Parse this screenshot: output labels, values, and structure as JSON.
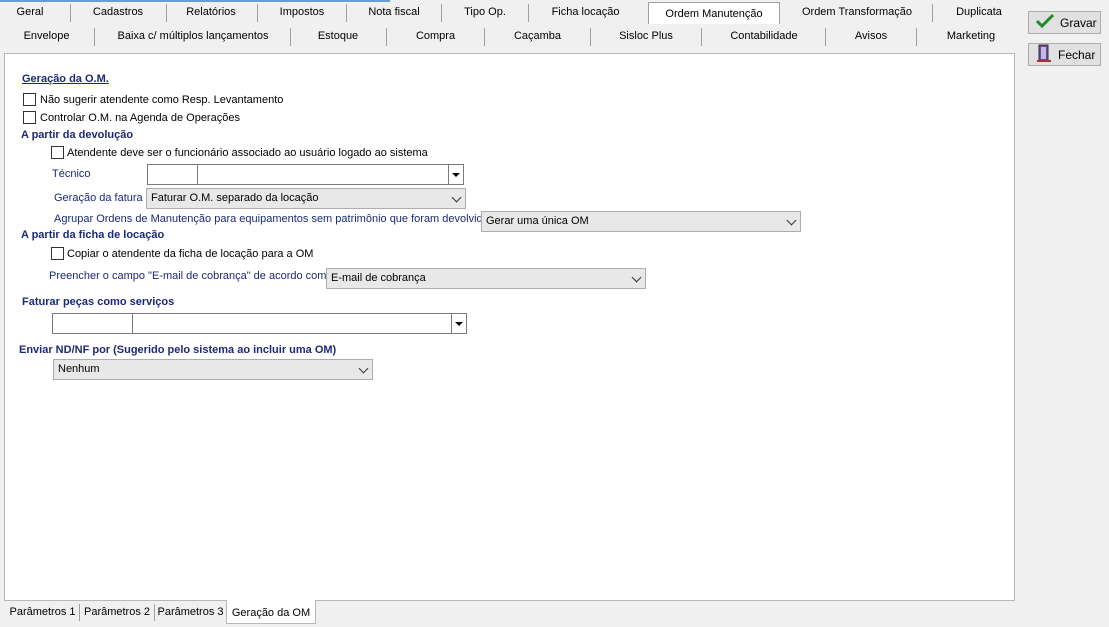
{
  "tabs_row1": [
    "Geral",
    "Cadastros",
    "Relatórios",
    "Impostos",
    "Nota fiscal",
    "Tipo Op.",
    "Ficha locação",
    "Ordem Manutenção",
    "Ordem Transformação",
    "Duplicata"
  ],
  "tabs_row2": [
    "Envelope",
    "Baixa c/ múltiplos lançamentos",
    "Estoque",
    "Compra",
    "Caçamba",
    "Sisloc Plus",
    "Contabilidade",
    "Avisos",
    "Marketing"
  ],
  "buttons": {
    "save": "Gravar",
    "close": "Fechar"
  },
  "geracao_om": {
    "title": "Geração da O.M.",
    "chk_nao_sugerir": "Não sugerir atendente como Resp. Levantamento",
    "chk_controlar": "Controlar O.M. na Agenda de Operações"
  },
  "devolucao": {
    "title": "A partir da devolução",
    "chk_atendente": "Atendente deve ser o funcionário associado ao usuário logado ao sistema",
    "tecnico_label": "Técnico",
    "tecnico_code": "",
    "tecnico_name": "",
    "geracao_fatura_label": "Geração da fatura",
    "geracao_fatura_value": "Faturar O.M. separado da locação",
    "agrupar_label": "Agrupar Ordens de Manutenção para equipamentos sem patrimônio que foram devolvidos",
    "agrupar_value": "Gerar uma única OM"
  },
  "ficha": {
    "title": "A partir da ficha de locação",
    "chk_copiar": "Copiar o atendente da ficha de locação para a OM",
    "email_label": "Preencher o campo \"E-mail de cobrança\" de acordo com",
    "email_value": "E-mail de cobrança"
  },
  "pecas": {
    "title": "Faturar peças como serviços",
    "code": "",
    "name": ""
  },
  "nd": {
    "title": "Enviar ND/NF por (Sugerido pelo sistema ao incluir uma OM)",
    "value": "Nenhum"
  },
  "bottom_tabs": [
    "Parâmetros 1",
    "Parâmetros 2",
    "Parâmetros 3",
    "Geração da OM"
  ]
}
